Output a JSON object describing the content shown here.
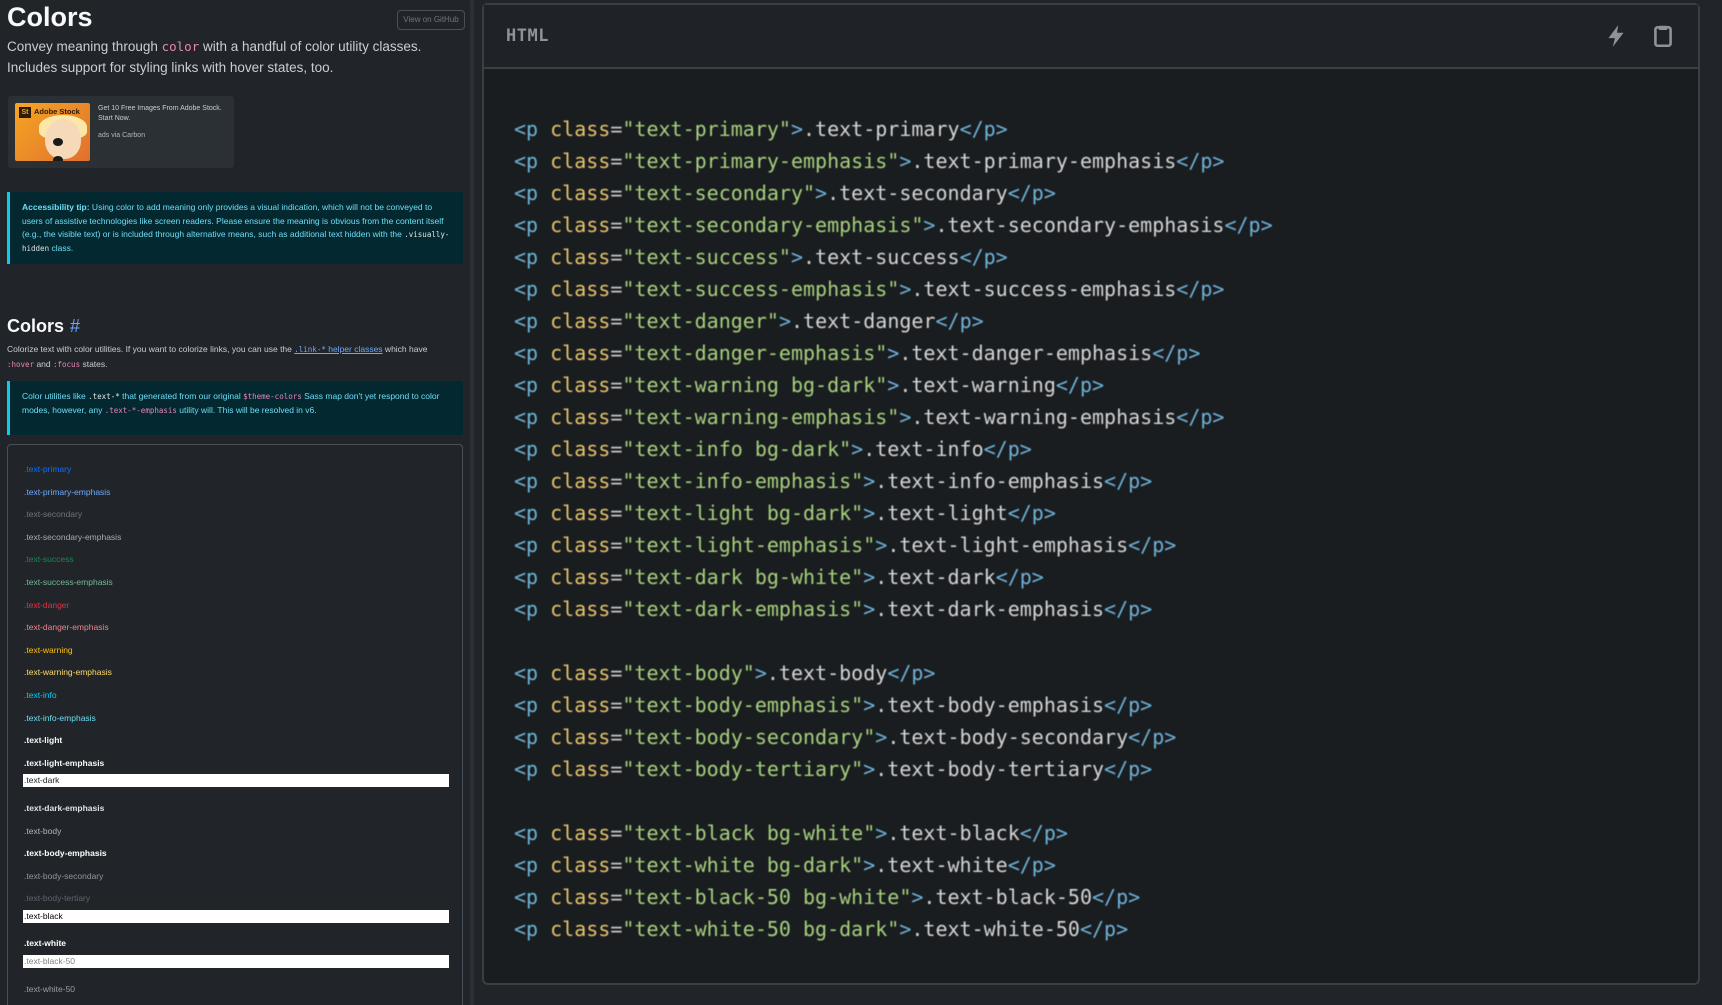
{
  "doc": {
    "title": "Colors",
    "github_button": "View on GitHub",
    "lead_prefix": "Convey meaning through ",
    "lead_code": "color",
    "lead_suffix": " with a handful of color utility classes. Includes support for styling links with hover states, too."
  },
  "ad": {
    "brand": "Adobe Stock",
    "brand_badge": "St",
    "text": "Get 10 Free Images From Adobe Stock. Start Now.",
    "via": "ads via Carbon"
  },
  "tip": {
    "label": "Accessibility tip:",
    "text": " Using color to add meaning only provides a visual indication, which will not be conveyed to users of assistive technologies like screen readers. Please ensure the meaning is obvious from the content itself (e.g., the visible text) or is included through alternative means, such as additional text hidden with the ",
    "code": ".visually-hidden",
    "suffix": " class."
  },
  "section": {
    "title": "Colors",
    "hash": "#",
    "desc_1": "Colorize text with color utilities. If you want to colorize links, you can use the ",
    "link_code": ".link-*",
    "link_text": " helper classes",
    "desc_2": " which have ",
    "code_hover": ":hover",
    "desc_and": " and ",
    "code_focus": ":focus",
    "desc_3": " states."
  },
  "note": {
    "t1": "Color utilities like ",
    "c1": ".text-*",
    "t2": " that generated from our original ",
    "c2": "$theme-colors",
    "t3": " Sass map don't yet respond to color modes, however, any ",
    "c3": ".text-*-emphasis",
    "t4": " utility will. This will be resolved in v6."
  },
  "examples": [
    {
      "label": ".text-primary",
      "color": "#0d6efd",
      "bg": ""
    },
    {
      "label": ".text-primary-emphasis",
      "color": "#6ea8fe",
      "bg": ""
    },
    {
      "label": ".text-secondary",
      "color": "#6c757d",
      "bg": ""
    },
    {
      "label": ".text-secondary-emphasis",
      "color": "#a7acb1",
      "bg": ""
    },
    {
      "label": ".text-success",
      "color": "#198754",
      "bg": ""
    },
    {
      "label": ".text-success-emphasis",
      "color": "#75b798",
      "bg": ""
    },
    {
      "label": ".text-danger",
      "color": "#dc3545",
      "bg": ""
    },
    {
      "label": ".text-danger-emphasis",
      "color": "#ea868f",
      "bg": ""
    },
    {
      "label": ".text-warning",
      "color": "#ffc107",
      "bg": "dark"
    },
    {
      "label": ".text-warning-emphasis",
      "color": "#ffda6a",
      "bg": ""
    },
    {
      "label": ".text-info",
      "color": "#0dcaf0",
      "bg": "dark"
    },
    {
      "label": ".text-info-emphasis",
      "color": "#6edff6",
      "bg": ""
    },
    {
      "label": ".text-light",
      "color": "#f8f9fa",
      "bg": "dark"
    },
    {
      "label": ".text-light-emphasis",
      "color": "#f8f9fa",
      "bg": ""
    },
    {
      "label": ".text-dark",
      "color": "#212529",
      "bg": "white"
    },
    {
      "label": ".text-dark-emphasis",
      "color": "#dee2e6",
      "bg": ""
    },
    {
      "label": ".text-body",
      "color": "#adb5bd",
      "bg": ""
    },
    {
      "label": ".text-body-emphasis",
      "color": "#ffffff",
      "bg": ""
    },
    {
      "label": ".text-body-secondary",
      "color": "#8f959b",
      "bg": ""
    },
    {
      "label": ".text-body-tertiary",
      "color": "#5f656b",
      "bg": ""
    },
    {
      "label": ".text-black",
      "color": "#000000",
      "bg": "white"
    },
    {
      "label": ".text-white",
      "color": "#ffffff",
      "bg": "dark"
    },
    {
      "label": ".text-black-50",
      "color": "#808080",
      "bg": "white"
    },
    {
      "label": ".text-white-50",
      "color": "#9a9ea2",
      "bg": "dark"
    }
  ],
  "code_panel": {
    "language": "HTML",
    "icons": [
      "lightning-icon",
      "clipboard-icon"
    ],
    "groups": [
      [
        {
          "cls": "text-primary",
          "txt": ".text-primary"
        },
        {
          "cls": "text-primary-emphasis",
          "txt": ".text-primary-emphasis"
        },
        {
          "cls": "text-secondary",
          "txt": ".text-secondary"
        },
        {
          "cls": "text-secondary-emphasis",
          "txt": ".text-secondary-emphasis"
        },
        {
          "cls": "text-success",
          "txt": ".text-success"
        },
        {
          "cls": "text-success-emphasis",
          "txt": ".text-success-emphasis"
        },
        {
          "cls": "text-danger",
          "txt": ".text-danger"
        },
        {
          "cls": "text-danger-emphasis",
          "txt": ".text-danger-emphasis"
        },
        {
          "cls": "text-warning bg-dark",
          "txt": ".text-warning"
        },
        {
          "cls": "text-warning-emphasis",
          "txt": ".text-warning-emphasis"
        },
        {
          "cls": "text-info bg-dark",
          "txt": ".text-info"
        },
        {
          "cls": "text-info-emphasis",
          "txt": ".text-info-emphasis"
        },
        {
          "cls": "text-light bg-dark",
          "txt": ".text-light"
        },
        {
          "cls": "text-light-emphasis",
          "txt": ".text-light-emphasis"
        },
        {
          "cls": "text-dark bg-white",
          "txt": ".text-dark"
        },
        {
          "cls": "text-dark-emphasis",
          "txt": ".text-dark-emphasis"
        }
      ],
      [
        {
          "cls": "text-body",
          "txt": ".text-body"
        },
        {
          "cls": "text-body-emphasis",
          "txt": ".text-body-emphasis"
        },
        {
          "cls": "text-body-secondary",
          "txt": ".text-body-secondary"
        },
        {
          "cls": "text-body-tertiary",
          "txt": ".text-body-tertiary"
        }
      ],
      [
        {
          "cls": "text-black bg-white",
          "txt": ".text-black"
        },
        {
          "cls": "text-white bg-dark",
          "txt": ".text-white"
        },
        {
          "cls": "text-black-50 bg-white",
          "txt": ".text-black-50"
        },
        {
          "cls": "text-white-50 bg-dark",
          "txt": ".text-white-50"
        }
      ]
    ]
  }
}
